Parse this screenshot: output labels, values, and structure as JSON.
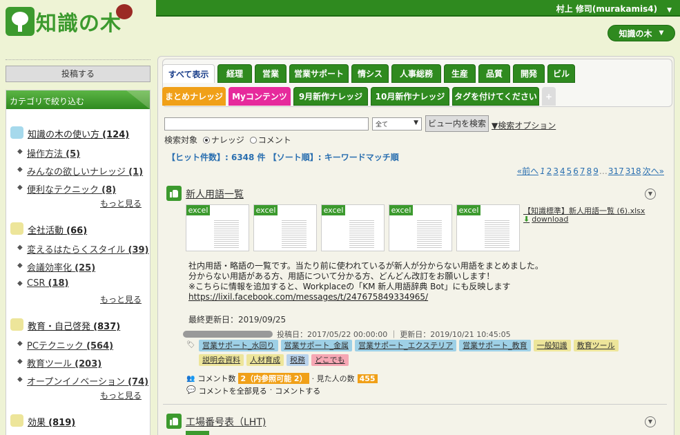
{
  "logo": {
    "text": "知識の木"
  },
  "header": {
    "user": "村上 修司(murakamis4)",
    "site_button": "知識の木"
  },
  "sidebar": {
    "post_button": "投稿する",
    "category_header": "カテゴリで絞り込む",
    "more_label": "もっと見る",
    "groups": [
      {
        "name": "知識の木の使い方",
        "count": "(124)",
        "color": "#a6d9ec",
        "subs": [
          {
            "name": "操作方法",
            "count": "(5)"
          },
          {
            "name": "みんなの欲しいナレッジ",
            "count": "(1)"
          },
          {
            "name": "便利なテクニック",
            "count": "(8)"
          }
        ]
      },
      {
        "name": "全社活動",
        "count": "(66)",
        "color": "#ede59a",
        "subs": [
          {
            "name": "変えるはたらくスタイル",
            "count": "(39)"
          },
          {
            "name": "会議効率化",
            "count": "(25)"
          },
          {
            "name": "CSR",
            "count": "(18)"
          }
        ]
      },
      {
        "name": "教育・自己啓発",
        "count": "(837)",
        "color": "#ede59a",
        "subs": [
          {
            "name": "PCテクニック",
            "count": "(564)"
          },
          {
            "name": "教育ツール",
            "count": "(203)"
          },
          {
            "name": "オープンイノベーション",
            "count": "(74)"
          }
        ]
      },
      {
        "name": "効果",
        "count": "(819)",
        "color": "#ede59a",
        "subs": []
      }
    ]
  },
  "tabs_row1": [
    "すべて表示",
    "経理",
    "営業",
    "営業サポート",
    "情シス",
    "人事総務",
    "生産",
    "品質",
    "開発",
    "ビル"
  ],
  "tabs_row2": [
    "まとめナレッジ",
    "Myコンテンツ",
    "9月新作ナレッジ",
    "10月新作ナレッジ",
    "タグを付けてください",
    "+"
  ],
  "search": {
    "value": "",
    "select": "全て",
    "view_search": "ビュー内を検索",
    "options": "▼検索オプション",
    "target_label": "検索対象",
    "radio1": "ナレッジ",
    "radio2": "コメント"
  },
  "results": {
    "summary": "【ヒット件数】: 6348 件 【ソート順】: キーワードマッチ順"
  },
  "pager": {
    "prev": "«前へ",
    "pages": [
      "1",
      "2",
      "3",
      "4",
      "5",
      "6",
      "7",
      "8",
      "9"
    ],
    "ellipsis": "…",
    "tail": [
      "317",
      "318"
    ],
    "next": "次へ»"
  },
  "item1": {
    "title": "新人用語一覧",
    "file_badge": "excel",
    "file_name": "【知識標準】新人用語一覧 (6).xlsx",
    "download": "download",
    "body": [
      "社内用語・略語の一覧です。当たり前に使われているが新人が分からない用語をまとめました。",
      "分からない用語がある方、用語について分かる方、どんどん改訂をお願いします！",
      "※こちらに情報を追加すると、Workplaceの「KM 新人用語辞典 Bot」にも反映します"
    ],
    "link": "https://lixil.facebook.com/messages/t/247675849334965/",
    "updated": "最終更新日：2019/09/25",
    "meta": "投稿日：2017/05/22 00:00:00 ｜ 更新日：2019/10/21 10:45:05",
    "tags_row1": [
      {
        "t": "営業サポート_水回り",
        "c": "blue"
      },
      {
        "t": "営業サポート_金属",
        "c": "blue"
      },
      {
        "t": "営業サポート_エクステリア",
        "c": "blue"
      },
      {
        "t": "営業サポート_教育",
        "c": "blue"
      },
      {
        "t": "一般知識",
        "c": "yel"
      },
      {
        "t": "教育ツール",
        "c": "yel"
      }
    ],
    "tags_row2": [
      {
        "t": "説明会資料",
        "c": "yel"
      },
      {
        "t": "人材育成",
        "c": "yel"
      },
      {
        "t": "税務",
        "c": "lblue"
      },
      {
        "t": "どこでも",
        "c": "pink"
      }
    ],
    "comments_label": "コメント数",
    "comments_count": "2（内参照可能 2）",
    "viewers_label": "· 見た人の数",
    "viewers_count": "455",
    "all_comments": "コメントを全部見る",
    "comment_action": "コメントする"
  },
  "item2": {
    "title": "工場番号表（LHT)"
  }
}
